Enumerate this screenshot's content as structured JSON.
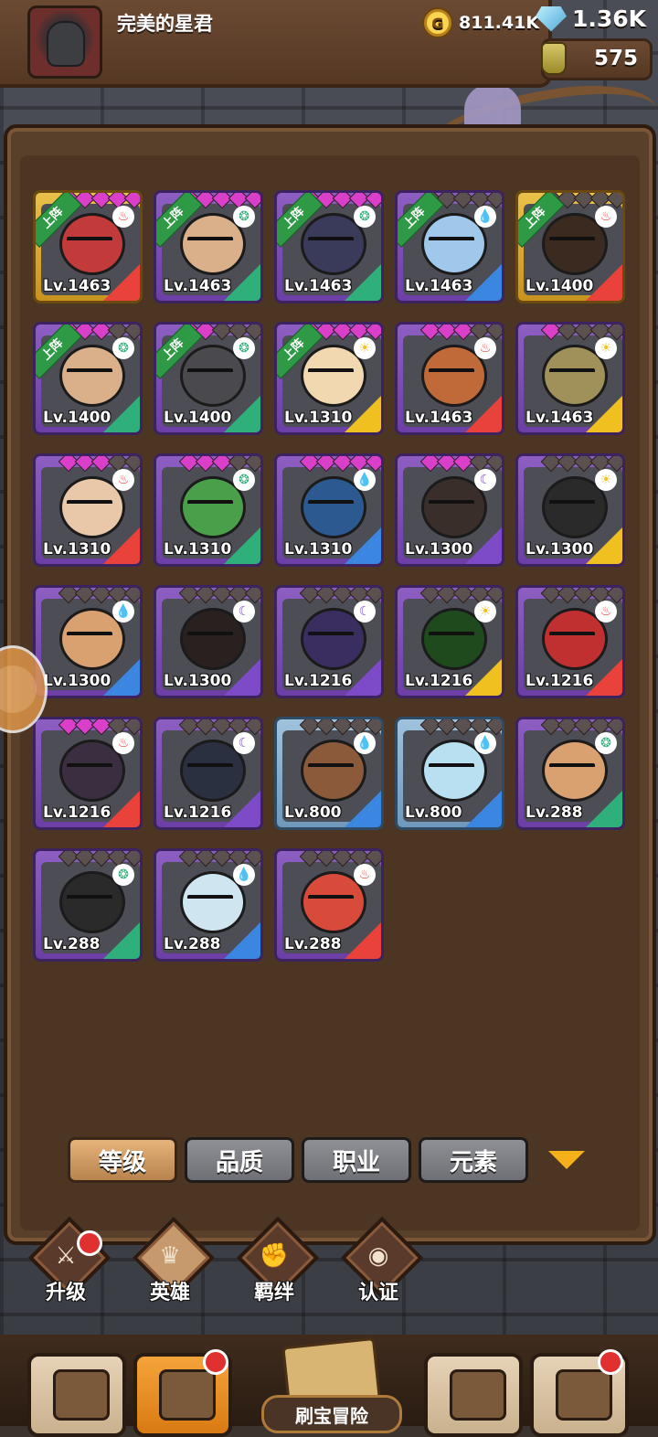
{
  "header": {
    "player_name": "完美的星君",
    "gold": "811.41K",
    "gems": "1.36K",
    "potions": "575"
  },
  "deploy_label": "上阵",
  "heroes": [
    {
      "level": "Lv.1463",
      "deployed": true,
      "frame": "gold",
      "element": "fire",
      "stars": [
        1,
        1,
        1,
        1,
        1
      ]
    },
    {
      "level": "Lv.1463",
      "deployed": true,
      "frame": "purple",
      "element": "wind",
      "stars": [
        1,
        1,
        1,
        1,
        1
      ]
    },
    {
      "level": "Lv.1463",
      "deployed": true,
      "frame": "purple",
      "element": "wind",
      "stars": [
        1,
        1,
        1,
        1,
        1
      ]
    },
    {
      "level": "Lv.1463",
      "deployed": true,
      "frame": "purple",
      "element": "water",
      "stars": [
        0,
        0,
        0,
        0,
        0
      ]
    },
    {
      "level": "Lv.1400",
      "deployed": true,
      "frame": "gold",
      "element": "fire",
      "stars": [
        0,
        0,
        0,
        0,
        0
      ]
    },
    {
      "level": "Lv.1400",
      "deployed": true,
      "frame": "purple",
      "element": "wind",
      "stars": [
        1,
        1,
        1,
        0,
        0
      ]
    },
    {
      "level": "Lv.1400",
      "deployed": true,
      "frame": "purple",
      "element": "wind",
      "stars": [
        1,
        1,
        0,
        0,
        0
      ]
    },
    {
      "level": "Lv.1310",
      "deployed": true,
      "frame": "purple",
      "element": "light",
      "stars": [
        1,
        1,
        1,
        1,
        1
      ]
    },
    {
      "level": "Lv.1463",
      "deployed": false,
      "frame": "purple",
      "element": "fire",
      "stars": [
        1,
        1,
        1,
        0,
        0
      ]
    },
    {
      "level": "Lv.1463",
      "deployed": false,
      "frame": "purple",
      "element": "light",
      "stars": [
        1,
        0,
        0,
        0,
        0
      ]
    },
    {
      "level": "Lv.1310",
      "deployed": false,
      "frame": "purple",
      "element": "fire",
      "stars": [
        1,
        1,
        1,
        0,
        0
      ]
    },
    {
      "level": "Lv.1310",
      "deployed": false,
      "frame": "purple",
      "element": "wind",
      "stars": [
        1,
        1,
        1,
        0,
        0
      ]
    },
    {
      "level": "Lv.1310",
      "deployed": false,
      "frame": "purple",
      "element": "water",
      "stars": [
        1,
        1,
        1,
        1,
        1
      ]
    },
    {
      "level": "Lv.1300",
      "deployed": false,
      "frame": "purple",
      "element": "dark",
      "stars": [
        1,
        1,
        1,
        0,
        0
      ]
    },
    {
      "level": "Lv.1300",
      "deployed": false,
      "frame": "purple",
      "element": "light",
      "stars": [
        0,
        0,
        0,
        0,
        0
      ]
    },
    {
      "level": "Lv.1300",
      "deployed": false,
      "frame": "purple",
      "element": "water",
      "stars": [
        0,
        0,
        0,
        0,
        0
      ]
    },
    {
      "level": "Lv.1300",
      "deployed": false,
      "frame": "purple",
      "element": "dark",
      "stars": [
        0,
        0,
        0,
        0,
        0
      ]
    },
    {
      "level": "Lv.1216",
      "deployed": false,
      "frame": "purple",
      "element": "dark",
      "stars": [
        0,
        0,
        0,
        0,
        0
      ]
    },
    {
      "level": "Lv.1216",
      "deployed": false,
      "frame": "purple",
      "element": "light",
      "stars": [
        0,
        0,
        0,
        0,
        0
      ]
    },
    {
      "level": "Lv.1216",
      "deployed": false,
      "frame": "purple",
      "element": "fire",
      "stars": [
        0,
        0,
        0,
        0,
        0
      ]
    },
    {
      "level": "Lv.1216",
      "deployed": false,
      "frame": "purple",
      "element": "fire",
      "stars": [
        1,
        1,
        1,
        0,
        0
      ]
    },
    {
      "level": "Lv.1216",
      "deployed": false,
      "frame": "purple",
      "element": "dark",
      "stars": [
        0,
        0,
        0,
        0,
        0
      ]
    },
    {
      "level": "Lv.800",
      "deployed": false,
      "frame": "blue",
      "element": "water",
      "stars": [
        0,
        0,
        0,
        0,
        0
      ]
    },
    {
      "level": "Lv.800",
      "deployed": false,
      "frame": "blue",
      "element": "water",
      "stars": [
        0,
        0,
        0,
        0,
        0
      ]
    },
    {
      "level": "Lv.288",
      "deployed": false,
      "frame": "purple",
      "element": "wind",
      "stars": [
        0,
        0,
        0,
        0,
        0
      ]
    },
    {
      "level": "Lv.288",
      "deployed": false,
      "frame": "purple",
      "element": "wind",
      "stars": [
        0,
        0,
        0,
        0,
        0
      ]
    },
    {
      "level": "Lv.288",
      "deployed": false,
      "frame": "purple",
      "element": "water",
      "stars": [
        0,
        0,
        0,
        0,
        0
      ]
    },
    {
      "level": "Lv.288",
      "deployed": false,
      "frame": "purple",
      "element": "fire",
      "stars": [
        0,
        0,
        0,
        0,
        0
      ]
    }
  ],
  "sort_buttons": [
    "等级",
    "品质",
    "职业",
    "元素"
  ],
  "sub_nav": [
    "升级",
    "英雄",
    "羁绊",
    "认证"
  ],
  "bottom_nav_center_label": "刷宝冒险",
  "colors": {
    "panel": "#59402b",
    "active_tab": "#f4a43a",
    "star_on": "#d93fc9",
    "deploy_banner": "#2f9a45"
  }
}
